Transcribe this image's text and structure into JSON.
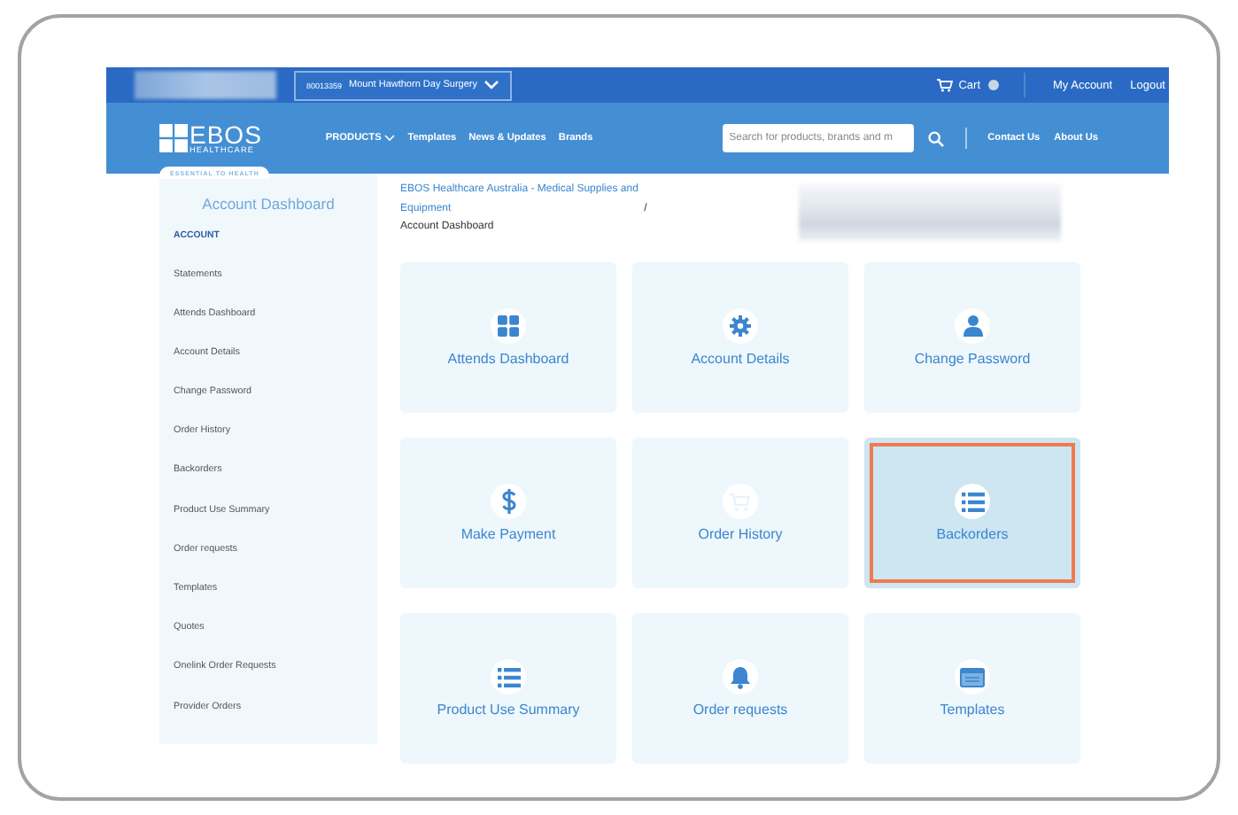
{
  "top_bar": {
    "account_number": "80013359",
    "account_name": "Mount Hawthorn Day Surgery",
    "cart": "Cart",
    "links": [
      "My Account",
      "Logout"
    ]
  },
  "nav": {
    "logo_text": "EBOS",
    "logo_subtext": "HEALTHCARE",
    "tagline": "ESSENTIAL TO HEALTH",
    "menu": [
      {
        "label": "PRODUCTS",
        "has_dropdown": true
      },
      {
        "label": "Templates",
        "has_dropdown": false
      },
      {
        "label": "News & Updates",
        "has_dropdown": false
      },
      {
        "label": "Brands",
        "has_dropdown": false
      }
    ],
    "search": {
      "placeholder": "Search for products, brands and m"
    },
    "links": [
      "Contact Us",
      "About Us"
    ]
  },
  "sidebar": {
    "title": "Account Dashboard",
    "section": "ACCOUNT",
    "items": [
      "Statements",
      "Attends Dashboard",
      "Account Details",
      "Change Password",
      "Order History",
      "Backorders",
      "Product Use Summary",
      "Order requests",
      "Templates",
      "Quotes",
      "Onelink Order Requests",
      "Provider Orders"
    ]
  },
  "breadcrumb": {
    "link": "EBOS Healthcare Australia - Medical Supplies and Equipment",
    "separator": "/",
    "current": "Account Dashboard"
  },
  "tiles": [
    {
      "label": "Attends Dashboard",
      "kind": "grid",
      "selected": false
    },
    {
      "label": "Account Details",
      "kind": "gear",
      "selected": false
    },
    {
      "label": "Change Password",
      "kind": "person",
      "selected": false
    },
    {
      "label": "Make Payment",
      "kind": "dollar",
      "selected": false
    },
    {
      "label": "Order History",
      "kind": "cart",
      "selected": false
    },
    {
      "label": "Backorders",
      "kind": "list",
      "selected": true
    },
    {
      "label": "Product Use Summary",
      "kind": "list",
      "selected": false
    },
    {
      "label": "Order requests",
      "kind": "bell",
      "selected": false
    },
    {
      "label": "Templates",
      "kind": "window",
      "selected": false
    }
  ]
}
